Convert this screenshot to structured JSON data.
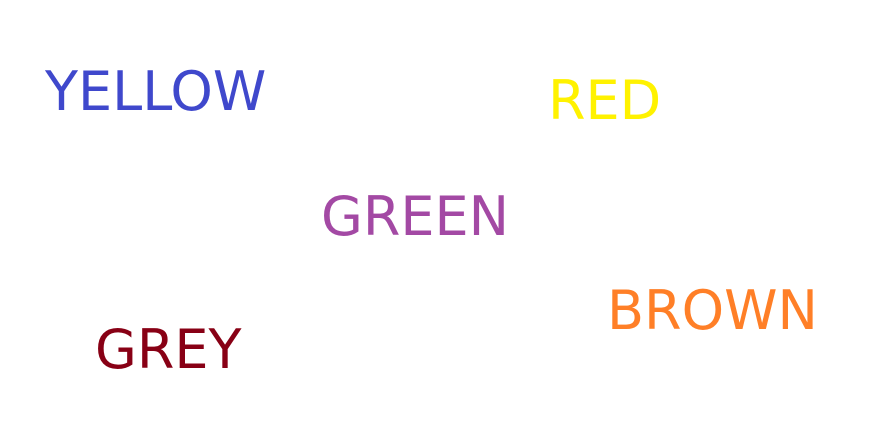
{
  "words": [
    {
      "text": "YELLOW",
      "color": "#3f48cc"
    },
    {
      "text": "RED",
      "color": "#fff200"
    },
    {
      "text": "GREEN",
      "color": "#a349a4"
    },
    {
      "text": "BROWN",
      "color": "#ff7f27"
    },
    {
      "text": "GREY",
      "color": "#880015"
    }
  ]
}
